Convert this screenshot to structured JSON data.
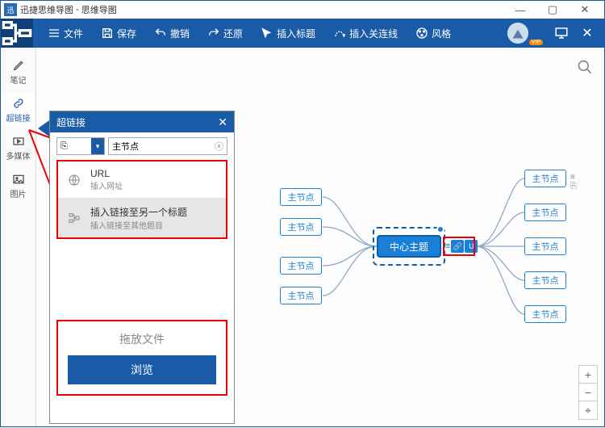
{
  "titlebar": {
    "app_name": "迅捷思维导图",
    "doc_name": "思维导图"
  },
  "toolbar": {
    "file": "文件",
    "save": "保存",
    "undo": "撤销",
    "redo": "还原",
    "insert_title": "插入标题",
    "insert_relation": "插入关连线",
    "style": "风格"
  },
  "sidebar": {
    "items": [
      {
        "label": "笔记"
      },
      {
        "label": "超链接"
      },
      {
        "label": "多媒体"
      },
      {
        "label": "图片"
      }
    ]
  },
  "panel": {
    "title": "超链接",
    "type_selected": "⎘",
    "target_value": "主节点",
    "opts": [
      {
        "label": "URL",
        "sub": "插入网址"
      },
      {
        "label": "插入链接至另一个标题",
        "sub": "插入链接至其他题目"
      }
    ],
    "drop_label": "拖放文件",
    "browse_label": "浏览"
  },
  "mindmap": {
    "center": "中心主题",
    "left_nodes": [
      "主节点",
      "主节点",
      "主节点",
      "主节点"
    ],
    "right_nodes": [
      "主节点",
      "主节点",
      "主节点",
      "主节点",
      "主节点"
    ]
  }
}
